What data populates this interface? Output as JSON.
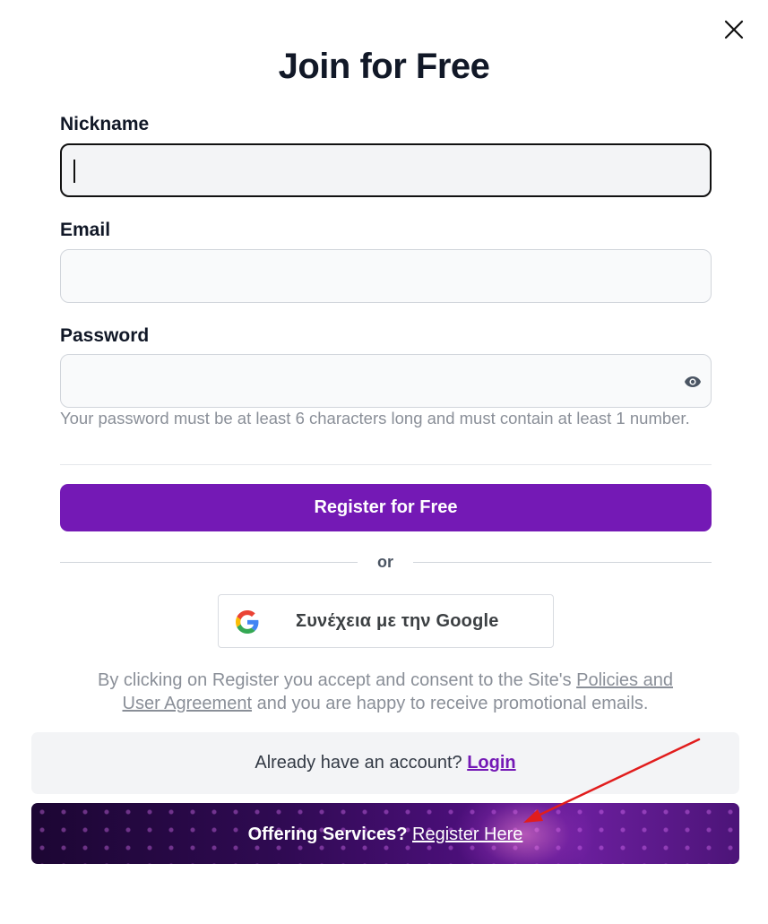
{
  "dialog": {
    "title": "Join for Free",
    "close_icon": "close-icon"
  },
  "form": {
    "nickname": {
      "label": "Nickname",
      "value": "",
      "placeholder": ""
    },
    "email": {
      "label": "Email",
      "value": "",
      "placeholder": ""
    },
    "password": {
      "label": "Password",
      "value": "",
      "placeholder": "",
      "toggle_icon": "eye-icon",
      "hint": "Your password must be at least 6 characters long and must contain at least 1 number."
    },
    "submit_label": "Register for Free"
  },
  "separator": {
    "label": "or"
  },
  "google": {
    "label": "Συνέχεια με την Google",
    "icon": "google-logo-icon"
  },
  "legal": {
    "prefix": "By clicking on Register you accept and consent to the Site's ",
    "link": "Policies and User Agreement",
    "suffix": " and you are happy to receive promotional emails."
  },
  "login": {
    "prompt": "Already have an account?",
    "link": "Login"
  },
  "services": {
    "prompt": "Offering Services?",
    "link": "Register Here"
  },
  "colors": {
    "accent": "#7419b5",
    "text": "#111827",
    "muted": "#8a8f98",
    "annotation": "#e11d1d"
  }
}
